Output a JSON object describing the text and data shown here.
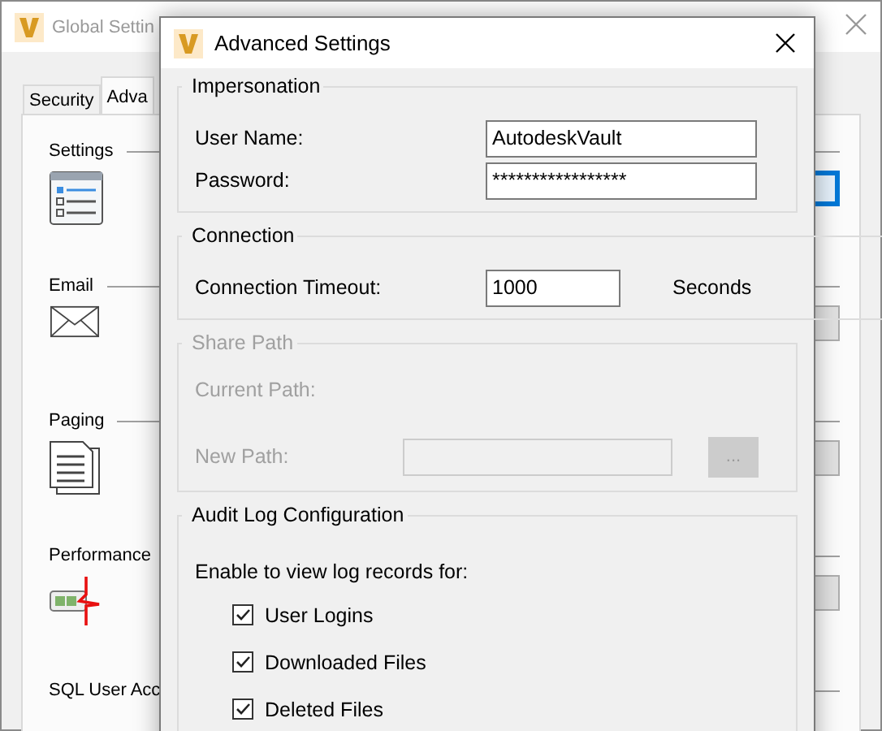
{
  "background_window": {
    "title": "Global Settin",
    "tabs": [
      {
        "label": "Security",
        "selected": false
      },
      {
        "label": "Adva",
        "selected": true
      }
    ],
    "sections": [
      {
        "title": "Settings",
        "button": {
          "focused": true
        }
      },
      {
        "title": "Email",
        "button": {
          "focused": false
        }
      },
      {
        "title": "Paging",
        "button": {
          "focused": false
        }
      },
      {
        "title": "Performance",
        "button": {
          "focused": false
        }
      },
      {
        "title": "SQL User Acc"
      }
    ]
  },
  "dialog": {
    "title": "Advanced Settings",
    "groups": [
      {
        "title": "Impersonation",
        "disabled": false,
        "rows": [
          {
            "kind": "field",
            "label": "User Name:",
            "value": "AutodeskVault"
          },
          {
            "kind": "field",
            "label": "Password:",
            "value": "*****************"
          }
        ]
      },
      {
        "title": "Connection",
        "disabled": false,
        "rows": [
          {
            "kind": "field",
            "label": "Connection Timeout:",
            "value": "1000",
            "unit": "Seconds"
          }
        ]
      },
      {
        "title": "Share Path",
        "disabled": true,
        "rows": [
          {
            "kind": "label",
            "label": "Current Path:"
          },
          {
            "kind": "browse",
            "label": "New Path:",
            "button": "..."
          }
        ]
      },
      {
        "title": "Audit Log Configuration",
        "disabled": false,
        "rows": [
          {
            "kind": "text",
            "label": "Enable to view log records for:"
          },
          {
            "kind": "checkbox",
            "label": "User Logins",
            "checked": true
          },
          {
            "kind": "checkbox",
            "label": "Downloaded Files",
            "checked": true
          },
          {
            "kind": "checkbox",
            "label": "Deleted Files",
            "checked": true
          }
        ]
      }
    ]
  }
}
